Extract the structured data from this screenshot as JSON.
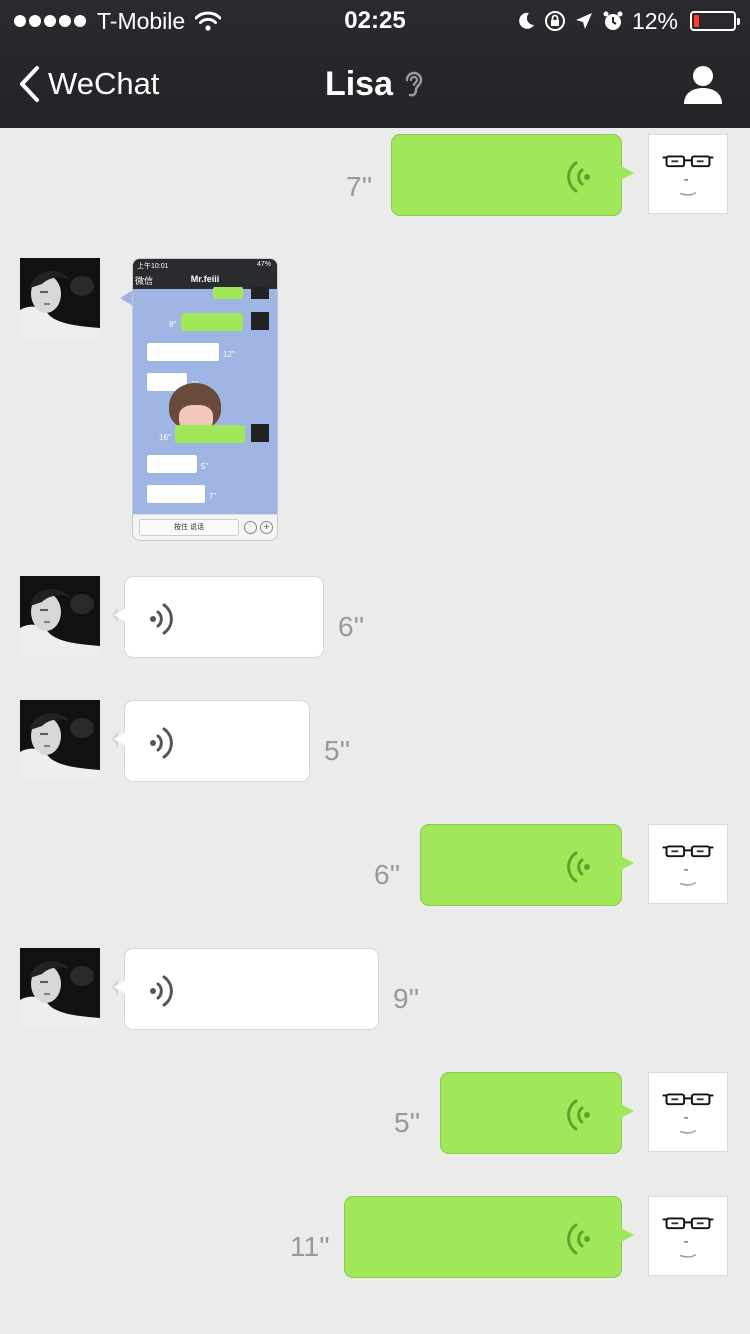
{
  "status_bar": {
    "carrier": "T-Mobile",
    "time": "02:25",
    "battery": "12%",
    "battery_level": 0.12
  },
  "nav": {
    "back_label": "WeChat",
    "title": "Lisa",
    "icons": [
      "chevron-left-icon",
      "ear-icon",
      "profile-icon"
    ]
  },
  "colors": {
    "header_bg": "#2a2b2f",
    "chat_bg": "#ebebeb",
    "outgoing_bubble": "#a0e75a",
    "incoming_bubble": "#ffffff",
    "voice_wave_out": "#5ba52a",
    "voice_wave_in": "#555555"
  },
  "messages": [
    {
      "sender": "me",
      "type": "voice",
      "duration": "7''"
    },
    {
      "sender": "Lisa",
      "type": "image",
      "image": {
        "title": "Mr.feiii",
        "back_label": "微信",
        "input_label": "按住 说话",
        "time": "上午10:01",
        "battery": "47%",
        "durations": [
          "8''",
          "12''",
          "3''",
          "16''",
          "5''",
          "7''"
        ]
      }
    },
    {
      "sender": "Lisa",
      "type": "voice",
      "duration": "6''"
    },
    {
      "sender": "Lisa",
      "type": "voice",
      "duration": "5''"
    },
    {
      "sender": "me",
      "type": "voice",
      "duration": "6''"
    },
    {
      "sender": "Lisa",
      "type": "voice",
      "duration": "9''"
    },
    {
      "sender": "me",
      "type": "voice",
      "duration": "5''"
    },
    {
      "sender": "me",
      "type": "voice",
      "duration": "11''"
    }
  ]
}
